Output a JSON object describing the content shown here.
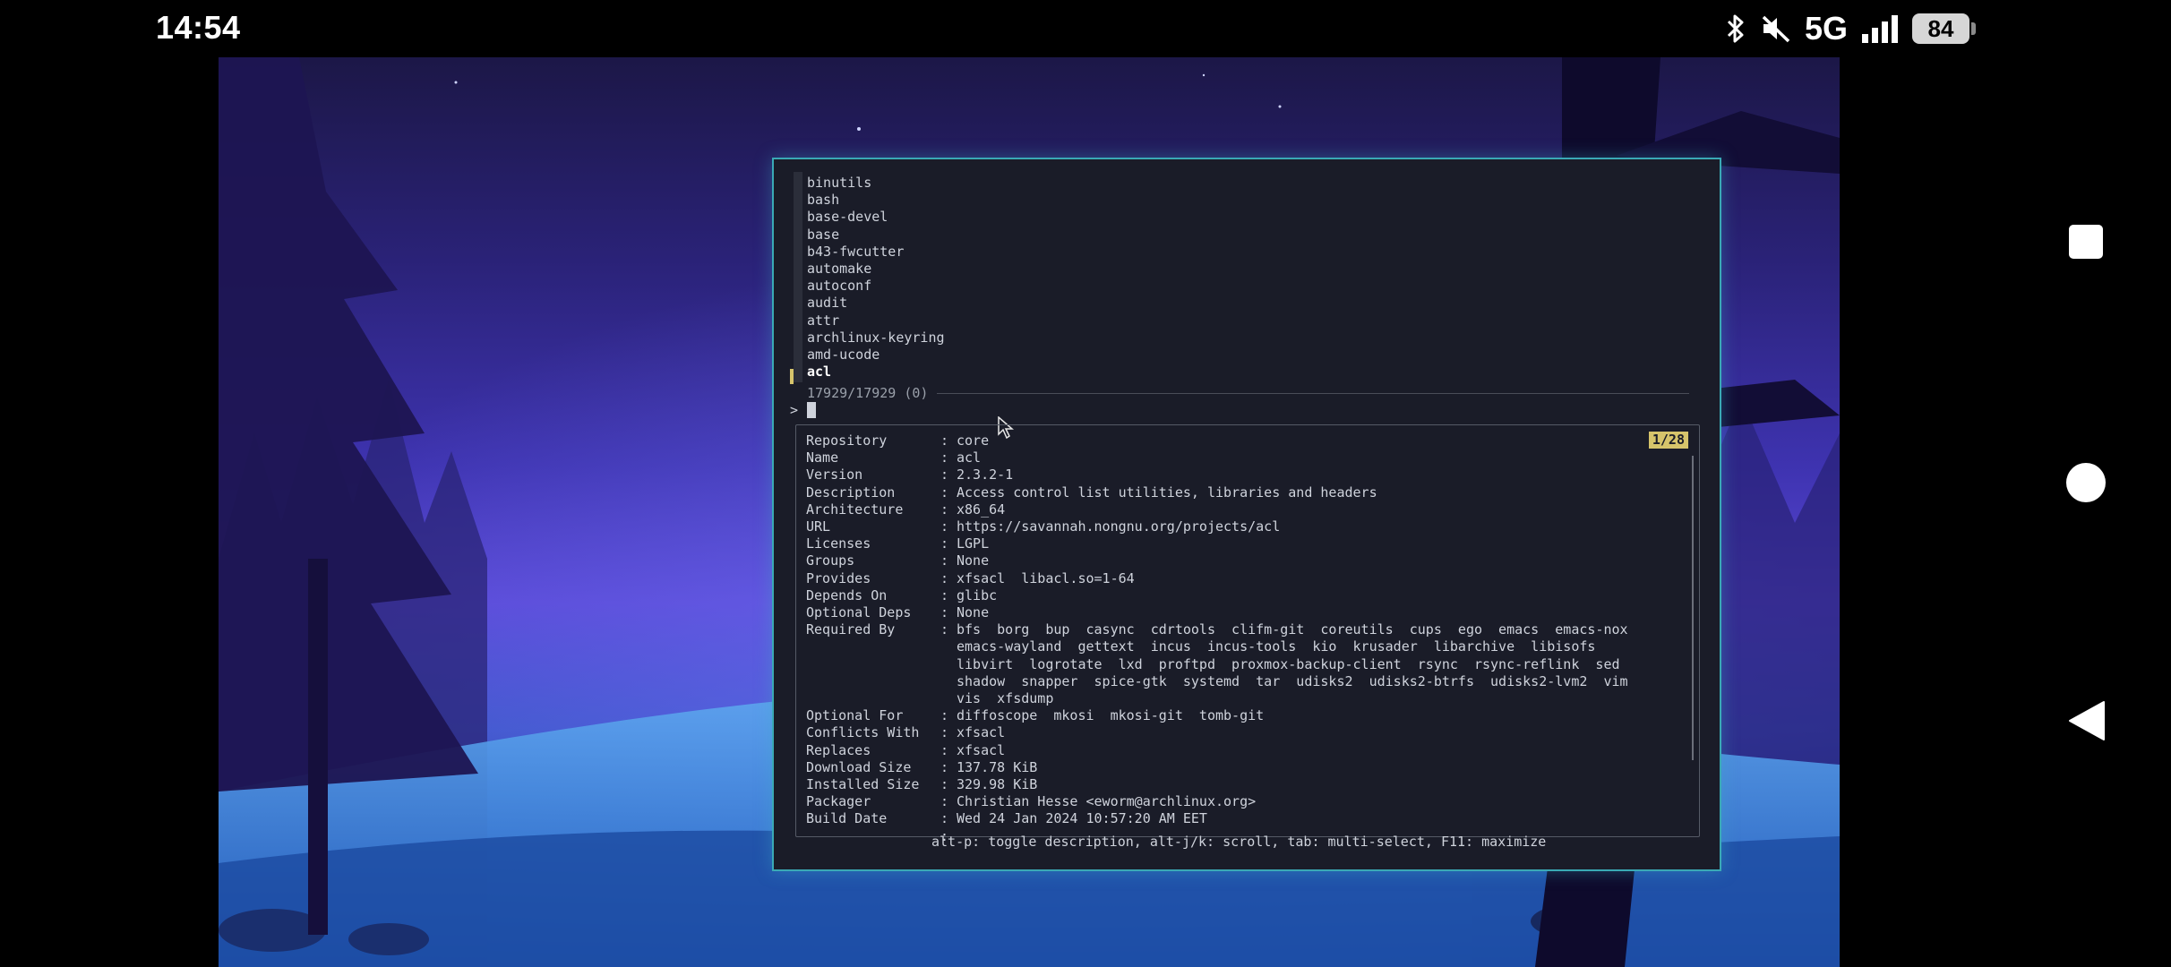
{
  "status_bar": {
    "time": "14:54",
    "network": "5G",
    "battery": "84",
    "icons": [
      "bluetooth-icon",
      "mute-icon",
      "signal-icon",
      "battery-icon"
    ]
  },
  "terminal": {
    "packages": [
      "binutils",
      "bash",
      "base-devel",
      "base",
      "b43-fwcutter",
      "automake",
      "autoconf",
      "audit",
      "attr",
      "archlinux-keyring",
      "amd-ucode",
      "acl"
    ],
    "selected": "acl",
    "count": "17929/17929 (0)",
    "prompt": ">",
    "preview": {
      "page": "1/28",
      "fields": [
        {
          "key": "Repository",
          "value": "core"
        },
        {
          "key": "Name",
          "value": "acl"
        },
        {
          "key": "Version",
          "value": "2.3.2-1"
        },
        {
          "key": "Description",
          "value": "Access control list utilities, libraries and headers"
        },
        {
          "key": "Architecture",
          "value": "x86_64"
        },
        {
          "key": "URL",
          "value": "https://savannah.nongnu.org/projects/acl"
        },
        {
          "key": "Licenses",
          "value": "LGPL"
        },
        {
          "key": "Groups",
          "value": "None"
        },
        {
          "key": "Provides",
          "value": "xfsacl  libacl.so=1-64"
        },
        {
          "key": "Depends On",
          "value": "glibc"
        },
        {
          "key": "Optional Deps",
          "value": "None"
        },
        {
          "key": "Required By",
          "value": "bfs  borg  bup  casync  cdrtools  clifm-git  coreutils  cups  ego  emacs  emacs-nox\nemacs-wayland  gettext  incus  incus-tools  kio  krusader  libarchive  libisofs\nlibvirt  logrotate  lxd  proftpd  proxmox-backup-client  rsync  rsync-reflink  sed\nshadow  snapper  spice-gtk  systemd  tar  udisks2  udisks2-btrfs  udisks2-lvm2  vim\nvis  xfsdump"
        },
        {
          "key": "Optional For",
          "value": "diffoscope  mkosi  mkosi-git  tomb-git"
        },
        {
          "key": "Conflicts With",
          "value": "xfsacl"
        },
        {
          "key": "Replaces",
          "value": "xfsacl"
        },
        {
          "key": "Download Size",
          "value": "137.78 KiB"
        },
        {
          "key": "Installed Size",
          "value": "329.98 KiB"
        },
        {
          "key": "Packager",
          "value": "Christian Hesse <eworm@archlinux.org>"
        },
        {
          "key": "Build Date",
          "value": "Wed 24 Jan 2024 10:57:20 AM EET"
        }
      ]
    },
    "hint": "alt-p: toggle description, alt-j/k: scroll, tab: multi-select, F11: maximize"
  },
  "nav": {
    "buttons": [
      "recent-apps",
      "home",
      "back"
    ]
  }
}
